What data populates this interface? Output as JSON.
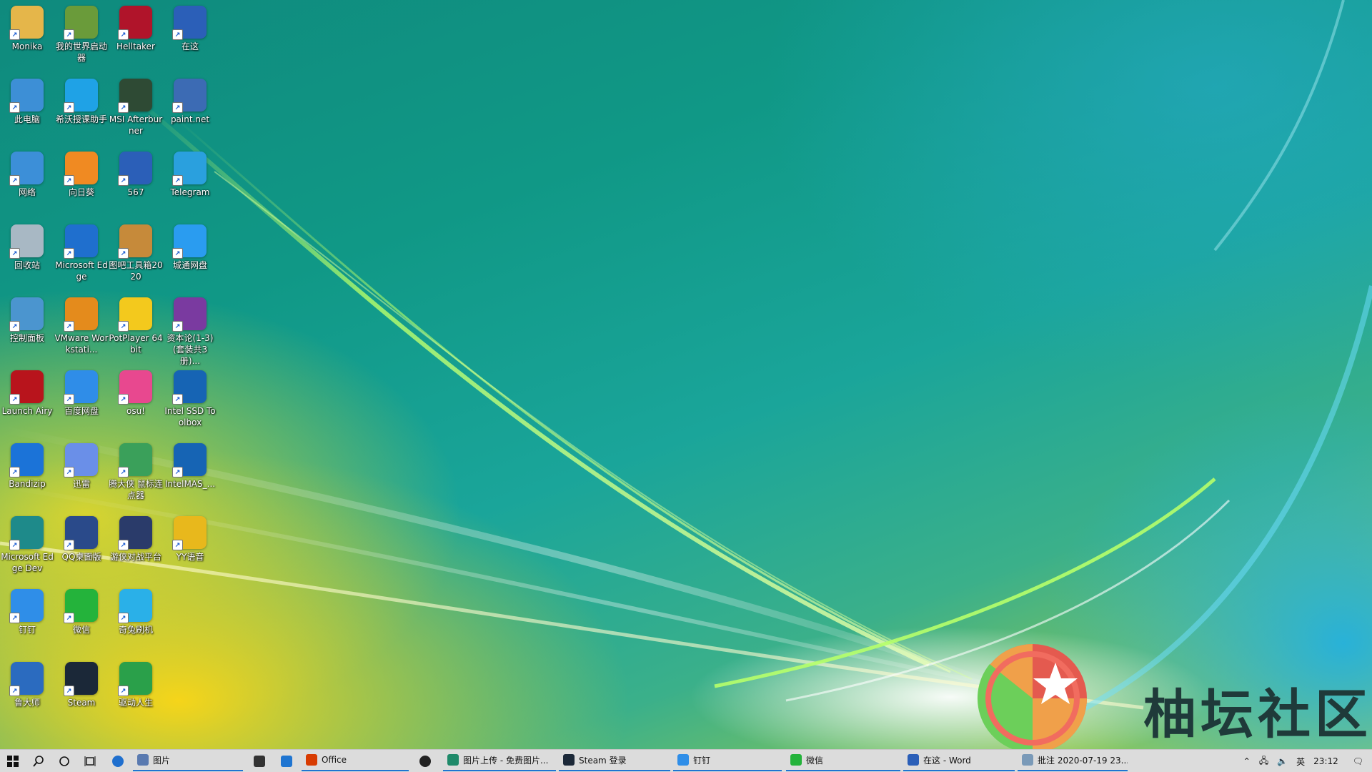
{
  "desktop": {
    "icons": [
      {
        "label": "Monika",
        "icon": "folder-person-icon",
        "color": "#e5b64a"
      },
      {
        "label": "我的世界启动器",
        "icon": "minecraft-icon",
        "color": "#6a9b3a"
      },
      {
        "label": "Helltaker",
        "icon": "helltaker-icon",
        "color": "#b0142a"
      },
      {
        "label": "在这",
        "icon": "word-doc-icon",
        "color": "#2b5fb8"
      },
      {
        "label": "此电脑",
        "icon": "computer-icon",
        "color": "#3d8fd6"
      },
      {
        "label": "希沃授课助手",
        "icon": "link-app-icon",
        "color": "#1fa2e6"
      },
      {
        "label": "MSI Afterburner",
        "icon": "msi-afterburner-icon",
        "color": "#2e4a34"
      },
      {
        "label": "paint.net",
        "icon": "paint-net-icon",
        "color": "#3c6bb4"
      },
      {
        "label": "网络",
        "icon": "network-icon",
        "color": "#3c8fd8"
      },
      {
        "label": "向日葵",
        "icon": "sunflower-icon",
        "color": "#f08a22"
      },
      {
        "label": "567",
        "icon": "word-doc-icon",
        "color": "#2b5fb8"
      },
      {
        "label": "Telegram",
        "icon": "telegram-icon",
        "color": "#2aa0de"
      },
      {
        "label": "回收站",
        "icon": "recycle-bin-icon",
        "color": "#a8b8c4"
      },
      {
        "label": "Microsoft Edge",
        "icon": "edge-icon",
        "color": "#1f6fce"
      },
      {
        "label": "图吧工具箱2020",
        "icon": "toolbox-icon",
        "color": "#c68a3a"
      },
      {
        "label": "城通网盘",
        "icon": "cloud-icon",
        "color": "#2a9cf0"
      },
      {
        "label": "控制面板",
        "icon": "control-panel-icon",
        "color": "#4b95cf"
      },
      {
        "label": "VMware Workstati...",
        "icon": "vmware-icon",
        "color": "#e48b1c"
      },
      {
        "label": "PotPlayer 64 bit",
        "icon": "potplayer-icon",
        "color": "#f3c91d"
      },
      {
        "label": "资本论(1-3)(套装共3册)...",
        "icon": "rar-icon",
        "color": "#7a3aa0"
      },
      {
        "label": "Launch Airy",
        "icon": "airy-icon",
        "color": "#b8141c"
      },
      {
        "label": "百度网盘",
        "icon": "baidu-netdisk-icon",
        "color": "#2f8de8"
      },
      {
        "label": "osu!",
        "icon": "osu-icon",
        "color": "#e8488f"
      },
      {
        "label": "Intel SSD Toolbox",
        "icon": "intel-icon",
        "color": "#1664b4"
      },
      {
        "label": "Bandizip",
        "icon": "bandizip-icon",
        "color": "#1b73d8"
      },
      {
        "label": "迅雷",
        "icon": "thunder-icon",
        "color": "#6a8fe8"
      },
      {
        "label": "腾大侠 鼠标连点器",
        "icon": "mouse-clicker-icon",
        "color": "#3aa05a"
      },
      {
        "label": "IntelMAS_...",
        "icon": "intel-icon",
        "color": "#1664b4"
      },
      {
        "label": "Microsoft Edge Dev",
        "icon": "edge-dev-icon",
        "color": "#1e8a8a"
      },
      {
        "label": "QQ桌面版",
        "icon": "qq-icon",
        "color": "#2a4a8a"
      },
      {
        "label": "游侠对战平台",
        "icon": "game-platform-icon",
        "color": "#2a3b6a"
      },
      {
        "label": "YY语音",
        "icon": "yy-icon",
        "color": "#e8b81c"
      },
      {
        "label": "钉钉",
        "icon": "dingtalk-icon",
        "color": "#2f8ee8"
      },
      {
        "label": "微信",
        "icon": "wechat-icon",
        "color": "#24b33b"
      },
      {
        "label": "奇兔刷机",
        "icon": "rabbit-icon",
        "color": "#2ab0e8"
      },
      {
        "label": "鲁大师",
        "icon": "ludashi-icon",
        "color": "#2b6bbf"
      },
      {
        "label": "Steam",
        "icon": "steam-icon",
        "color": "#1b2838"
      },
      {
        "label": "驱动人生",
        "icon": "driver-icon",
        "color": "#2aa04a"
      }
    ]
  },
  "watermark": {
    "text": "柚坛社区",
    "icon": "youtan-logo-icon"
  },
  "taskbar": {
    "pinned_search_app": "图片",
    "apps": [
      {
        "label": "Office",
        "icon": "office-icon",
        "color": "#d83b01"
      },
      {
        "label": "图片上传 - 免费图片...",
        "icon": "browser-icon",
        "color": "#1f8a6a"
      },
      {
        "label": "Steam 登录",
        "icon": "steam-icon",
        "color": "#1b2838"
      },
      {
        "label": "钉钉",
        "icon": "dingtalk-icon",
        "color": "#2f8ee8"
      },
      {
        "label": "微信",
        "icon": "wechat-icon",
        "color": "#24b33b"
      },
      {
        "label": "在这 - Word",
        "icon": "word-icon",
        "color": "#2b5fb8"
      },
      {
        "label": "批注 2020-07-19 23...",
        "icon": "snip-icon",
        "color": "#7a9ab8"
      }
    ],
    "tray": {
      "ime": "英",
      "time": "23:12"
    }
  }
}
